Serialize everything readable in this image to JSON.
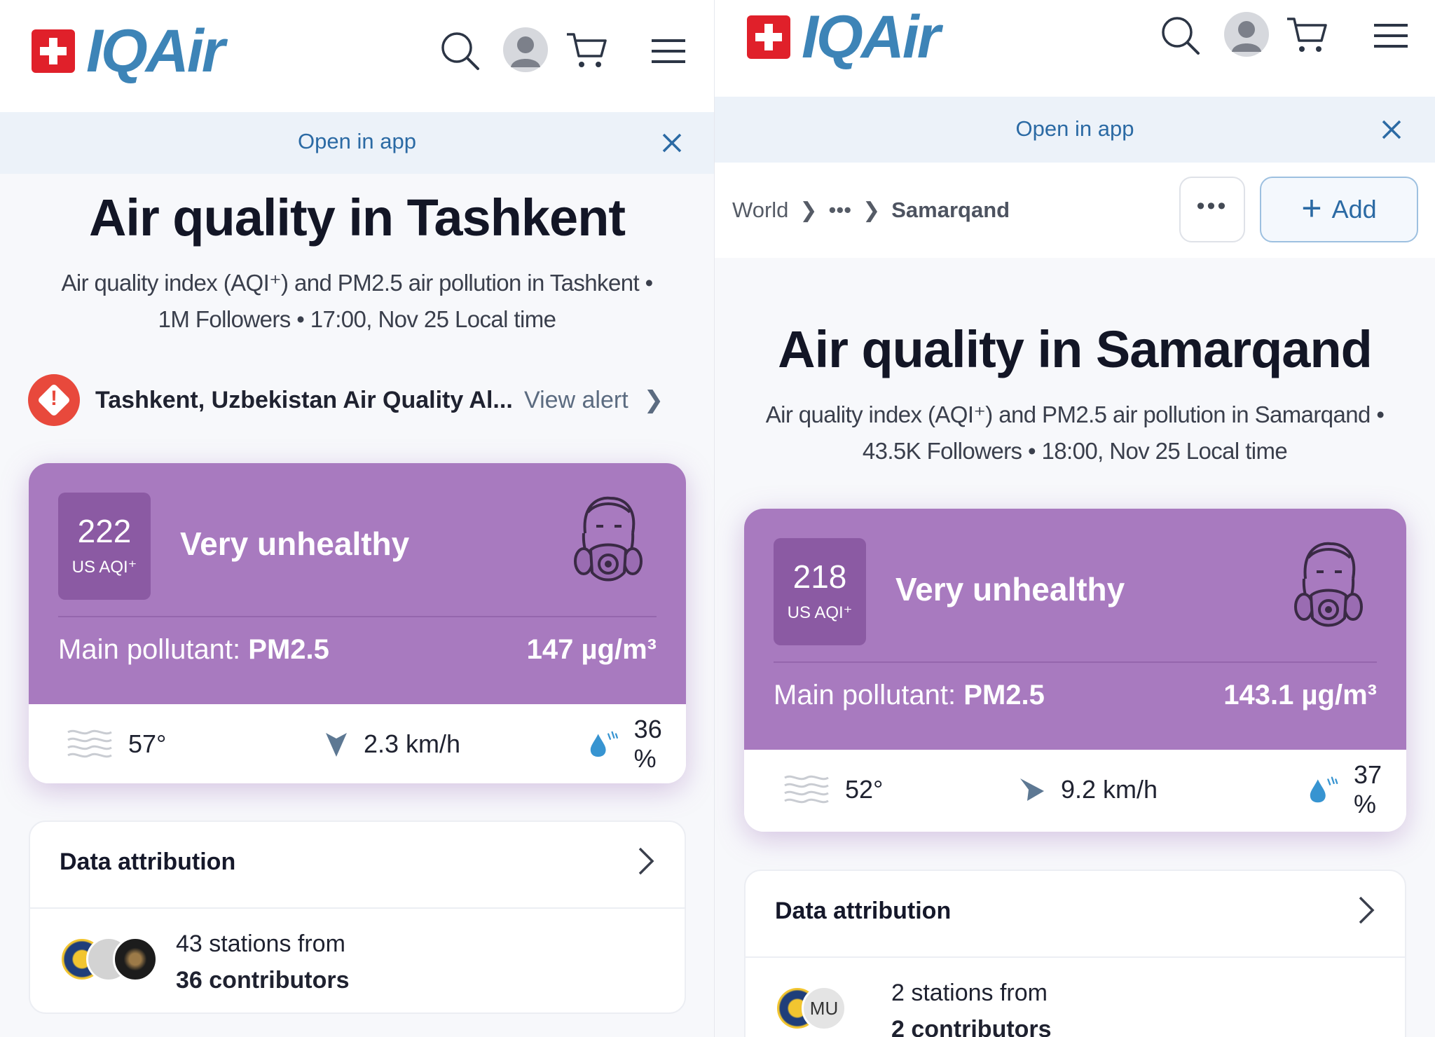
{
  "left": {
    "brand": "IQAir",
    "open_in_app": "Open in app",
    "title": "Air quality in Tashkent",
    "subtitle_line1": "Air quality index (AQI⁺) and PM2.5 air pollution in Tashkent •",
    "subtitle_line2": "1M Followers • 17:00, Nov 25 Local time",
    "alert": {
      "text": "Tashkent, Uzbekistan Air Quality Al...",
      "link": "View alert"
    },
    "aqi": {
      "value": "222",
      "unit": "US AQI⁺",
      "level": "Very unhealthy",
      "pollutant_label": "Main pollutant:",
      "pollutant": "PM2.5",
      "concentration": "147 µg/m³",
      "temperature": "57°",
      "wind": "2.3 km/h",
      "humidity": "36 %"
    },
    "attribution": {
      "title": "Data attribution",
      "line1": "43 stations from",
      "line2": "36 contributors"
    }
  },
  "right": {
    "brand": "IQAir",
    "open_in_app": "Open in app",
    "breadcrumb": {
      "world": "World",
      "ellipsis": "•••",
      "current": "Samarqand"
    },
    "more_button": "•••",
    "add_button": "Add",
    "title": "Air quality in Samarqand",
    "subtitle_line1": "Air quality index (AQI⁺) and PM2.5 air pollution in Samarqand •",
    "subtitle_line2": "43.5K Followers • 18:00, Nov 25 Local time",
    "aqi": {
      "value": "218",
      "unit": "US AQI⁺",
      "level": "Very unhealthy",
      "pollutant_label": "Main pollutant:",
      "pollutant": "PM2.5",
      "concentration": "143.1 µg/m³",
      "temperature": "52°",
      "wind": "9.2 km/h",
      "humidity": "37 %"
    },
    "attribution": {
      "title": "Data attribution",
      "line1": "2 stations from",
      "line2": "2 contributors",
      "avatar_initials": "MU"
    }
  },
  "icons": [
    "swiss-flag-icon",
    "search-icon",
    "avatar-icon",
    "cart-icon",
    "menu-icon",
    "close-icon",
    "alert-icon",
    "mask-icon",
    "haze-icon",
    "wind-arrow-icon",
    "humidity-icon",
    "chevron-right-icon",
    "plus-icon"
  ],
  "colors": {
    "aqi_purple": "#a87abf",
    "aqi_badge": "#8b5aa3",
    "brand_blue": "#3d84b7",
    "link_blue": "#2b6aa4",
    "swiss_red": "#e0202a",
    "alert_red": "#e8493c"
  }
}
